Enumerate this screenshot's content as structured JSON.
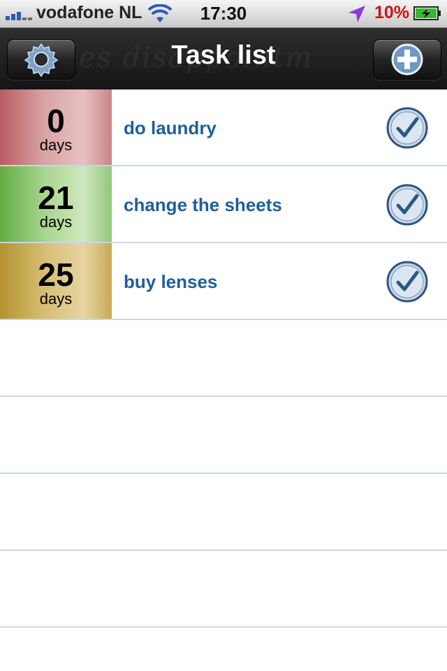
{
  "status_bar": {
    "carrier": "vodafone NL",
    "time": "17:30",
    "battery_percent": "10%",
    "icons": [
      "signal-icon",
      "wifi-icon",
      "location-arrow-icon",
      "battery-charging-icon"
    ]
  },
  "nav": {
    "title": "Task list",
    "watermark": "dishes  disappointm",
    "left_button": "settings-gear-icon",
    "right_button": "add-plus-icon"
  },
  "tasks": [
    {
      "count": "0",
      "unit": "days",
      "title": "do laundry",
      "badge_color": "#c97c7e"
    },
    {
      "count": "21",
      "unit": "days",
      "title": "change the sheets",
      "badge_color": "#8cc46e"
    },
    {
      "count": "25",
      "unit": "days",
      "title": "buy lenses",
      "badge_color": "#c7a84e"
    }
  ],
  "colors": {
    "task_text": "#1f5f99",
    "separator": "#cad6e2",
    "battery_text": "#c8161d"
  }
}
